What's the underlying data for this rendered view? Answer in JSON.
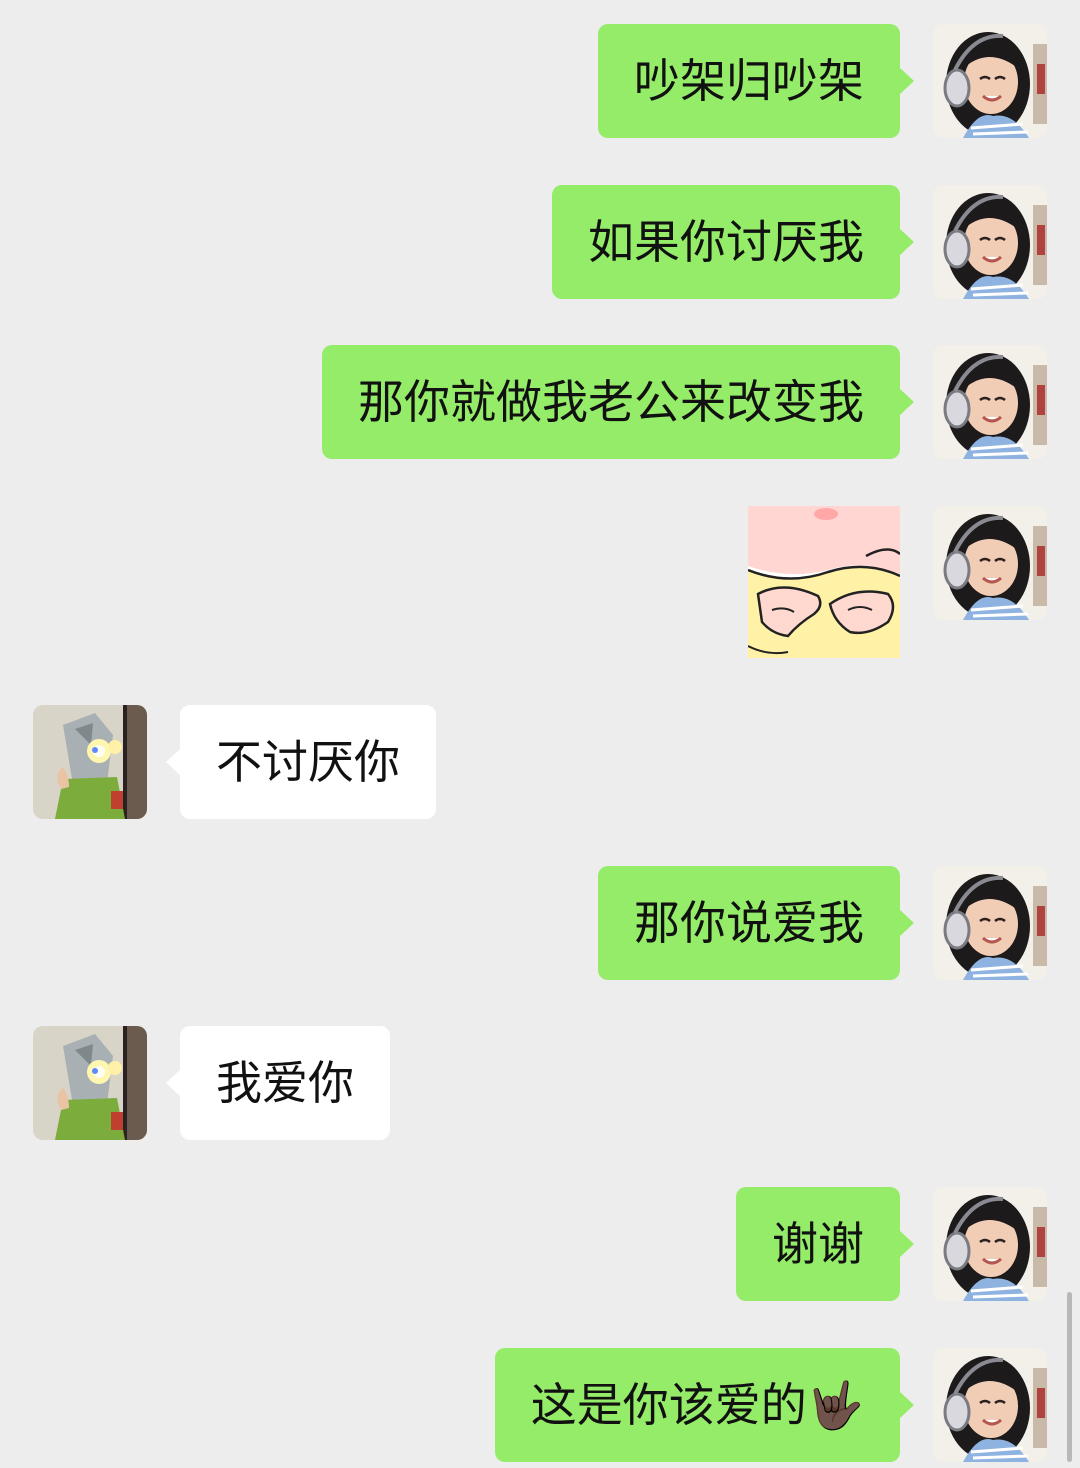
{
  "messages": [
    {
      "sender": "me",
      "text": "吵架归吵架"
    },
    {
      "sender": "me",
      "text": "如果你讨厌我"
    },
    {
      "sender": "me",
      "text": "那你就做我老公来改变我"
    },
    {
      "sender": "me",
      "type": "sticker",
      "sticker": "cartoon-fingers-poking-sticker"
    },
    {
      "sender": "them",
      "text": "不讨厌你"
    },
    {
      "sender": "me",
      "text": "那你说爱我"
    },
    {
      "sender": "them",
      "text": "我爱你"
    },
    {
      "sender": "me",
      "text": "谢谢"
    },
    {
      "sender": "me",
      "text": "这是你该爱的🤟🏿"
    }
  ],
  "colors": {
    "background": "#ededed",
    "outgoing_bubble": "#95ec69",
    "incoming_bubble": "#ffffff",
    "text": "#111111"
  }
}
